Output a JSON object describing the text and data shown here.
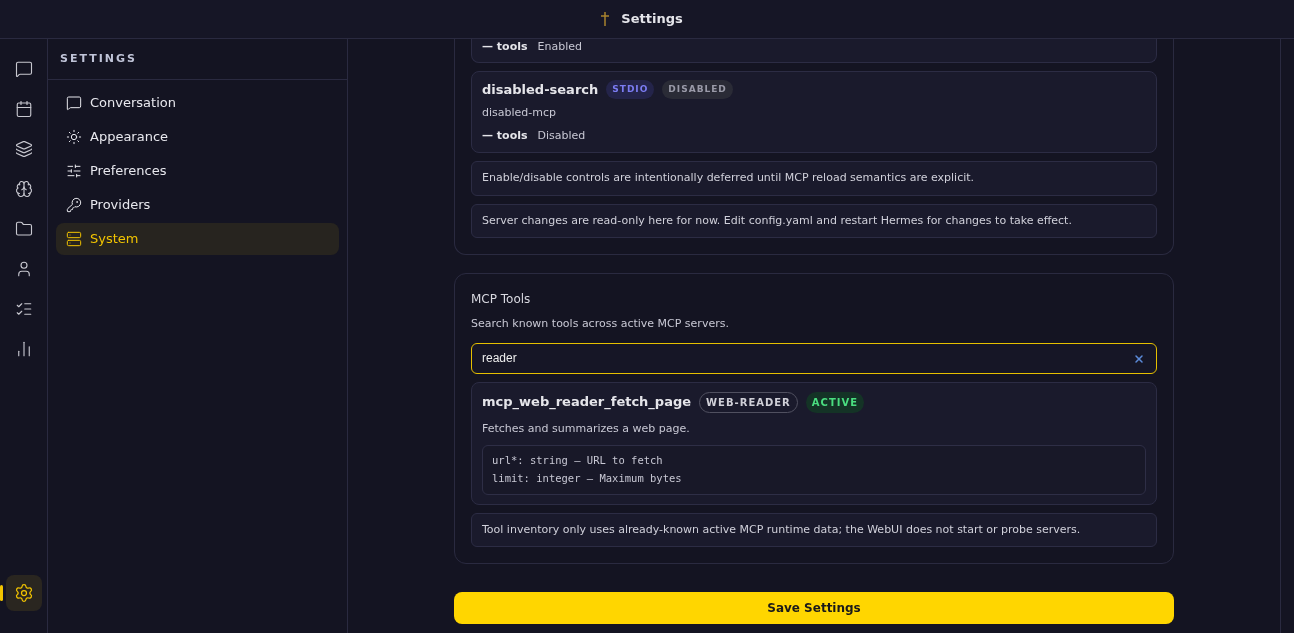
{
  "header": {
    "title": "Settings"
  },
  "rail": [
    {
      "kind": "chat",
      "selected": false
    },
    {
      "kind": "calendar",
      "selected": false
    },
    {
      "kind": "layers",
      "selected": false
    },
    {
      "kind": "brain",
      "selected": false
    },
    {
      "kind": "folder",
      "selected": false
    },
    {
      "kind": "user",
      "selected": false
    },
    {
      "kind": "checklist",
      "selected": false
    },
    {
      "kind": "chart",
      "selected": false
    }
  ],
  "rail_bottom": {
    "kind": "settings",
    "selected": true
  },
  "sidebar": {
    "title": "SETTINGS",
    "items": [
      {
        "kind": "chat",
        "label": "Conversation",
        "selected": false
      },
      {
        "kind": "sun",
        "label": "Appearance",
        "selected": false
      },
      {
        "kind": "sliders",
        "label": "Preferences",
        "selected": false
      },
      {
        "kind": "key",
        "label": "Providers",
        "selected": false
      },
      {
        "kind": "server",
        "label": "System",
        "selected": true
      }
    ]
  },
  "servers": [
    {
      "kind": "cut",
      "tools_count": "— tools",
      "status": "Enabled"
    },
    {
      "kind": "full",
      "name": "disabled-search",
      "transport": "STDIO",
      "state": "DISABLED",
      "command": "disabled-mcp",
      "tools_count": "— tools",
      "status": "Disabled"
    }
  ],
  "server_notes": [
    "Enable/disable controls are intentionally deferred until MCP reload semantics are explicit.",
    "Server changes are read-only here for now. Edit config.yaml and restart Hermes for changes to take effect."
  ],
  "tools": {
    "title": "MCP Tools",
    "description": "Search known tools across active MCP servers.",
    "search_value": "reader",
    "results": [
      {
        "name": "mcp_web_reader_fetch_page",
        "server": "WEB-READER",
        "state": "ACTIVE",
        "description": "Fetches and summarizes a web page.",
        "params": [
          "url*: string — URL to fetch",
          "limit: integer — Maximum bytes"
        ]
      }
    ],
    "note": "Tool inventory only uses already-known active MCP runtime data; the WebUI does not start or probe servers."
  },
  "save_button": "Save Settings"
}
